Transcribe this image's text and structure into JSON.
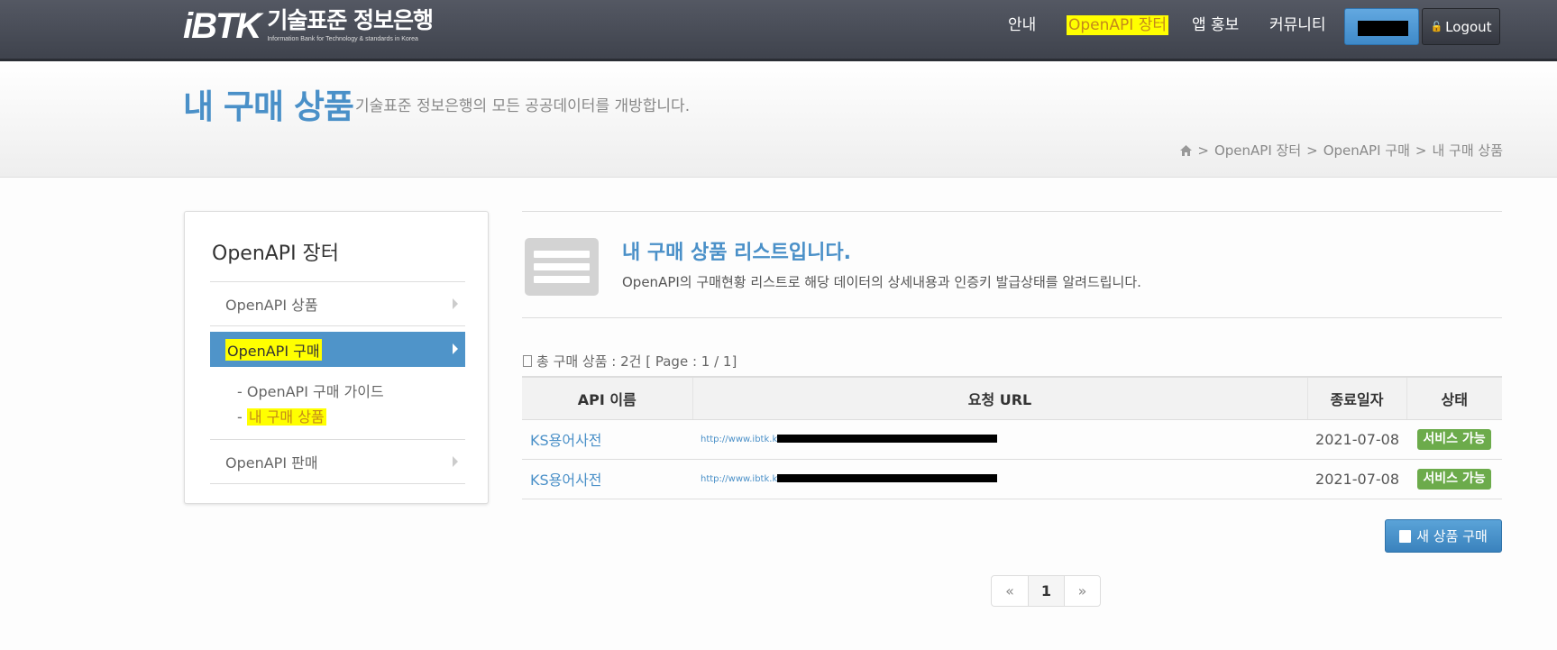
{
  "header": {
    "logo_mark": "iBTK",
    "logo_title": "기술표준 정보은행",
    "logo_subtitle": "Information Bank for Technology & standards in Korea",
    "nav": [
      "안내",
      "OpenAPI 장터",
      "앱 홍보",
      "커뮤니티"
    ],
    "nav_active_index": 1,
    "logout_label": "Logout"
  },
  "page": {
    "title": "내 구매 상품",
    "subtitle": "기술표준 정보은행의 모든 공공데이터를 개방합니다.",
    "breadcrumb": [
      "OpenAPI 장터",
      "OpenAPI 구매",
      "내 구매 상품"
    ]
  },
  "sidebar": {
    "title": "OpenAPI 장터",
    "items": [
      {
        "label": "OpenAPI 상품"
      },
      {
        "label": "OpenAPI 구매"
      },
      {
        "label": "OpenAPI 판매"
      }
    ],
    "sub_items": [
      "OpenAPI 구매 가이드",
      "내 구매 상품"
    ]
  },
  "intro": {
    "title": "내 구매 상품 리스트입니다.",
    "description": "OpenAPI의 구매현황 리스트로 해당 데이터의 상세내용과 인증키 발급상태를 알려드립니다."
  },
  "summary": "총 구매 상품 : 2건 [ Page : 1 / 1]",
  "table": {
    "headers": [
      "API 이름",
      "요청 URL",
      "종료일자",
      "상태"
    ],
    "rows": [
      {
        "name": "KS용어사전",
        "url": "http://www.ibtk.k",
        "end_date": "2021-07-08",
        "status": "서비스 가능"
      },
      {
        "name": "KS용어사전",
        "url": "http://www.ibtk.k",
        "end_date": "2021-07-08",
        "status": "서비스 가능"
      }
    ]
  },
  "new_purchase_label": "새 상품 구매",
  "pagination": {
    "prev": "«",
    "current": "1",
    "next": "»"
  },
  "colors": {
    "accent": "#4a90c8",
    "status_ok": "#6cab4b",
    "highlight": "#ffff00"
  }
}
